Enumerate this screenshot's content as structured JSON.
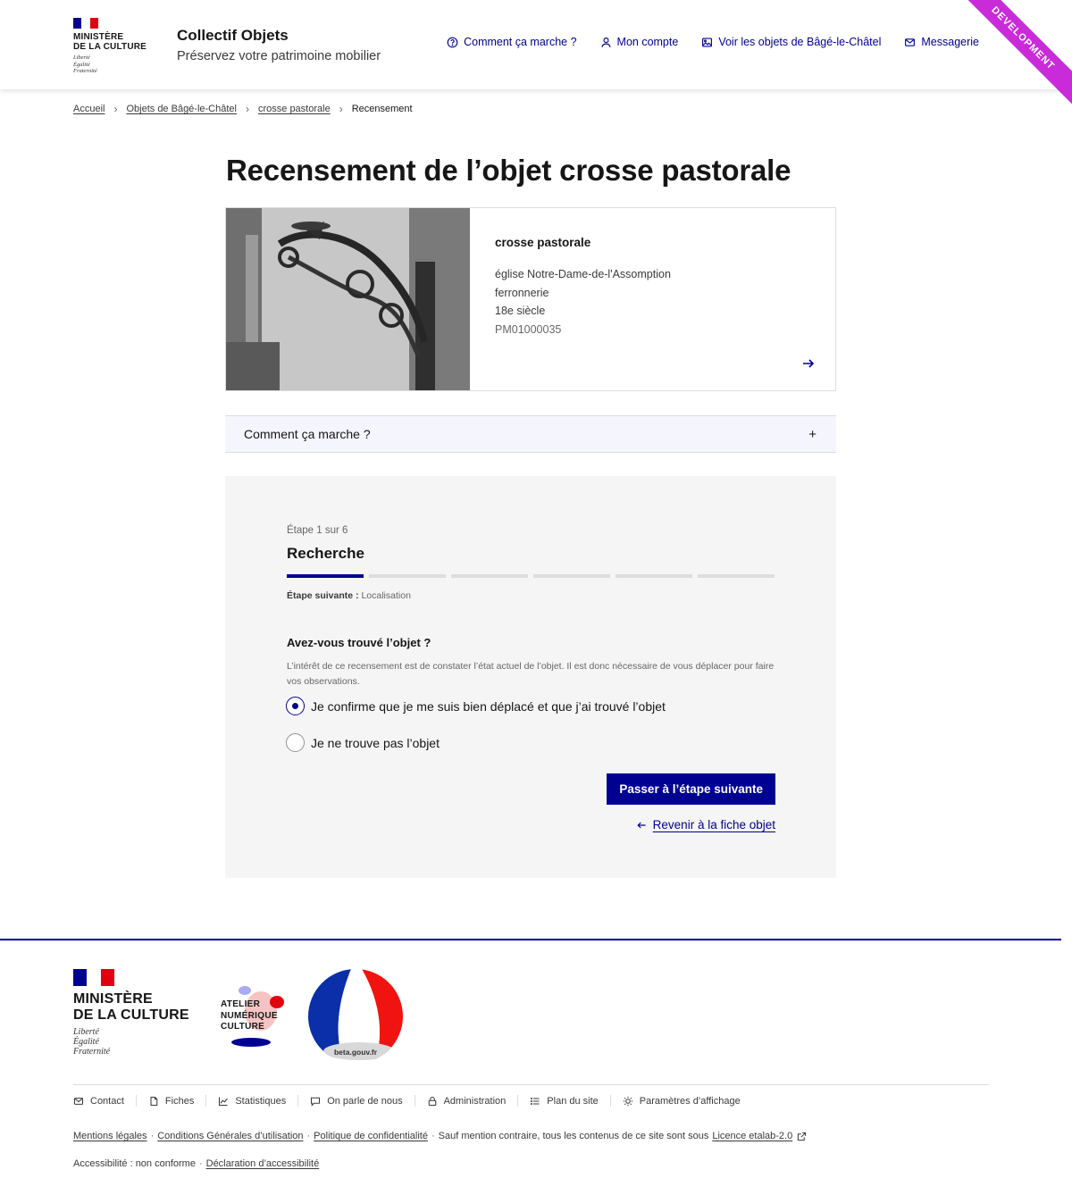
{
  "header": {
    "ministere": {
      "line1": "MINISTÈRE",
      "line2": "DE LA CULTURE",
      "devise": [
        "Liberté",
        "Égalité",
        "Fraternité"
      ]
    },
    "service_title": "Collectif Objets",
    "service_tagline": "Préservez votre patrimoine mobilier",
    "nav": [
      {
        "label": "Comment ça marche ?",
        "icon": "question-circle-icon"
      },
      {
        "label": "Mon compte",
        "icon": "user-icon"
      },
      {
        "label": "Voir les objets de Bâgé-le-Châtel",
        "icon": "image-icon"
      },
      {
        "label": "Messagerie",
        "icon": "mail-icon"
      }
    ],
    "ribbon": "DEVELOPMENT"
  },
  "breadcrumb": {
    "items": [
      "Accueil",
      "Objets de Bâgé-le-Châtel",
      "crosse pastorale"
    ],
    "current": "Recensement"
  },
  "page_title": "Recensement de l’objet crosse pastorale",
  "object_card": {
    "title": "crosse pastorale",
    "lines": [
      "église Notre-Dame-de-l'Assomption",
      "ferronnerie",
      "18e siècle"
    ],
    "reference": "PM01000035"
  },
  "accordion": {
    "label": "Comment ça marche ?",
    "toggle": "+"
  },
  "form": {
    "step_count": "Étape 1 sur 6",
    "step_title": "Recherche",
    "current_step": 1,
    "total_steps": 6,
    "next_step_label": "Étape suivante :",
    "next_step_value": "Localisation",
    "question": "Avez-vous trouvé l’objet ?",
    "hint": "L’intérêt de ce recensement est de constater l’état actuel de l’objet. Il est donc nécessaire de vous déplacer pour faire vos observations.",
    "options": [
      {
        "label": "Je confirme que je me suis bien déplacé et que j’ai trouvé l’objet",
        "checked": true
      },
      {
        "label": "Je ne trouve pas l’objet",
        "checked": false
      }
    ],
    "submit_label": "Passer à l’étape suivante",
    "back_label": "Revenir à la fiche objet"
  },
  "footer": {
    "ministere": {
      "line1": "MINISTÈRE",
      "line2": "DE LA CULTURE",
      "devise": [
        "Liberté",
        "Égalité",
        "Fraternité"
      ]
    },
    "atelier": [
      "ATELIER",
      "NUMÉRIQUE",
      "CULTURE"
    ],
    "beta": "beta.gouv.fr",
    "links": [
      {
        "label": "Contact",
        "icon": "mail-icon"
      },
      {
        "label": "Fiches",
        "icon": "document-icon"
      },
      {
        "label": "Statistiques",
        "icon": "chart-icon"
      },
      {
        "label": "On parle de nous",
        "icon": "chat-icon"
      },
      {
        "label": "Administration",
        "icon": "lock-icon"
      },
      {
        "label": "Plan du site",
        "icon": "list-icon"
      },
      {
        "label": "Paramètres d’affichage",
        "icon": "sun-icon"
      }
    ],
    "legal": {
      "mentions": "Mentions légales",
      "cgu": "Conditions Générales d’utilisation",
      "privacy": "Politique de confidentialité",
      "notice": "Sauf mention contraire, tous les contenus de ce site sont sous",
      "licence": "Licence etalab-2.0"
    },
    "accessibility": {
      "status": "Accessibilité : non conforme",
      "declaration": "Déclaration d’accessibilité"
    }
  },
  "colors": {
    "primary": "#000091",
    "flag_blue": "#000091",
    "flag_red": "#e1000f",
    "ribbon": "#c92bd9"
  }
}
